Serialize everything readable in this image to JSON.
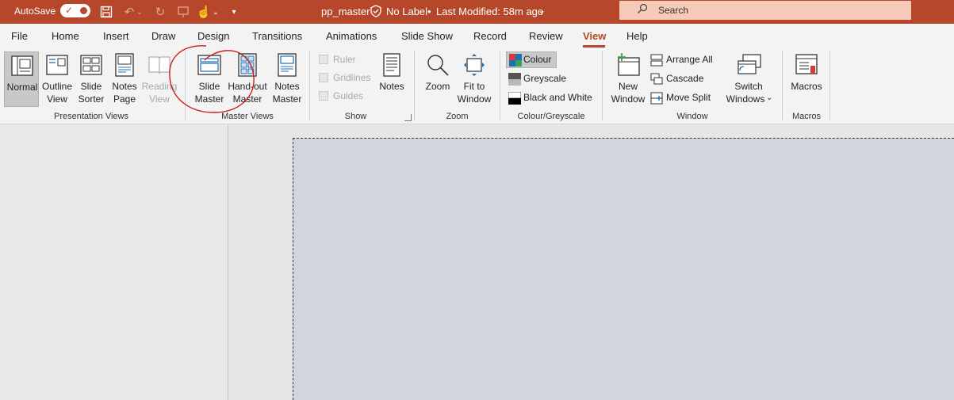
{
  "titlebar": {
    "autosave_label": "AutoSave",
    "autosave_state": "on",
    "doc_title": "pp_master",
    "sensitivity_label": "No Label",
    "separator": "•",
    "last_modified": "Last Modified: 58m ago",
    "search_placeholder": "Search",
    "accent_color": "#b7472a"
  },
  "tabs": [
    "File",
    "Home",
    "Insert",
    "Draw",
    "Design",
    "Transitions",
    "Animations",
    "Slide Show",
    "Record",
    "Review",
    "View",
    "Help"
  ],
  "active_tab": "View",
  "ribbon": {
    "presentation_views": {
      "label": "Presentation Views",
      "normal": "Normal",
      "outline_1": "Outline",
      "outline_2": "View",
      "sorter_1": "Slide",
      "sorter_2": "Sorter",
      "notes_page_1": "Notes",
      "notes_page_2": "Page",
      "reading_1": "Reading",
      "reading_2": "View"
    },
    "master_views": {
      "label": "Master Views",
      "slide_master_1": "Slide",
      "slide_master_2": "Master",
      "handout_master_1": "Hand-out",
      "handout_master_2": "Master",
      "notes_master_1": "Notes",
      "notes_master_2": "Master"
    },
    "show": {
      "label": "Show",
      "ruler": "Ruler",
      "gridlines": "Gridlines",
      "guides": "Guides",
      "notes": "Notes"
    },
    "zoom": {
      "label": "Zoom",
      "zoom": "Zoom",
      "fit_1": "Fit to",
      "fit_2": "Window"
    },
    "colour_greyscale": {
      "label": "Colour/Greyscale",
      "colour": "Colour",
      "greyscale": "Greyscale",
      "black_white": "Black and White"
    },
    "window": {
      "label": "Window",
      "new_1": "New",
      "new_2": "Window",
      "arrange_all": "Arrange All",
      "cascade": "Cascade",
      "move_split": "Move Split",
      "switch_1": "Switch",
      "switch_2": "Windows"
    },
    "macros": {
      "label": "Macros",
      "macros": "Macros"
    }
  }
}
